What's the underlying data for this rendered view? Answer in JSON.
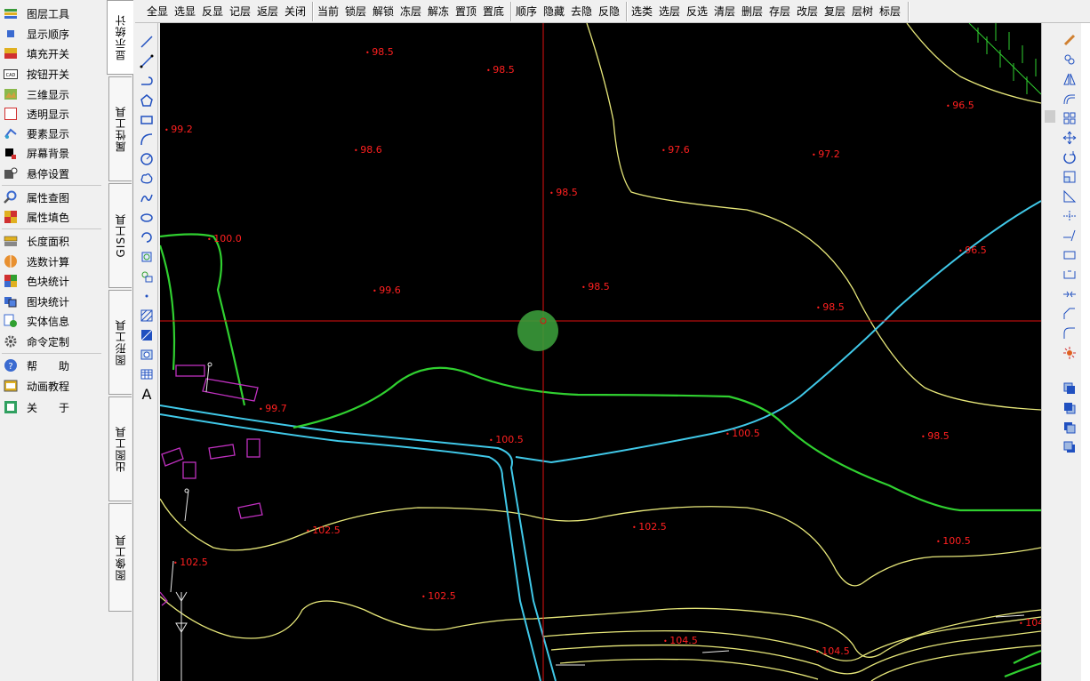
{
  "left_menu": [
    {
      "label": "图层工具",
      "icon": "layer-tool-icon"
    },
    {
      "label": "显示顺序",
      "icon": "display-order-icon"
    },
    {
      "label": "填充开关",
      "icon": "fill-toggle-icon"
    },
    {
      "label": "按钮开关",
      "icon": "cad-button-icon"
    },
    {
      "label": "三维显示",
      "icon": "3d-display-icon"
    },
    {
      "label": "透明显示",
      "icon": "transparent-icon"
    },
    {
      "label": "要素显示",
      "icon": "feature-display-icon"
    },
    {
      "label": "屏幕背景",
      "icon": "screen-bg-icon"
    },
    {
      "label": "悬停设置",
      "icon": "hover-settings-icon"
    },
    {
      "label": "属性查图",
      "icon": "attribute-search-icon"
    },
    {
      "label": "属性填色",
      "icon": "attribute-fill-icon"
    },
    {
      "label": "长度面积",
      "icon": "length-area-icon"
    },
    {
      "label": "选数计算",
      "icon": "calc-icon"
    },
    {
      "label": "色块统计",
      "icon": "color-block-icon"
    },
    {
      "label": "图块统计",
      "icon": "block-stat-icon"
    },
    {
      "label": "实体信息",
      "icon": "entity-info-icon"
    },
    {
      "label": "命令定制",
      "icon": "gear-icon"
    },
    {
      "label": "帮　　助",
      "icon": "help-icon"
    },
    {
      "label": "动画教程",
      "icon": "tutorial-icon"
    },
    {
      "label": "关　　于",
      "icon": "about-icon"
    }
  ],
  "vertical_tabs": [
    "显示统计",
    "属性工具",
    "GIS工具",
    "图形工具",
    "出图工具",
    "图像工具"
  ],
  "toolbar": {
    "group1": [
      "全显",
      "选显",
      "反显",
      "记层",
      "返层",
      "关闭"
    ],
    "group2": [
      "当前",
      "锁层",
      "解锁",
      "冻层",
      "解冻",
      "置顶",
      "置底"
    ],
    "group3": [
      "顺序",
      "隐藏",
      "去隐",
      "反隐"
    ],
    "group4": [
      "选类",
      "选层",
      "反选",
      "清层",
      "删层",
      "存层",
      "改层",
      "复层",
      "层树",
      "标层"
    ]
  },
  "elevations": [
    "98.5",
    "98.5",
    "99.2",
    "98.6",
    "97.6",
    "97.2",
    "96.5",
    "98.5",
    "100.0",
    "96.5",
    "99.6",
    "98.5",
    "98.5",
    "99.7",
    "100.5",
    "100.5",
    "98.5",
    "102.5",
    "102.5",
    "100.5",
    "102.5",
    "102.5",
    "104.5",
    "104.5",
    "104"
  ],
  "colors": {
    "canvas_bg": "#000000",
    "contour": "#e8e87a",
    "river": "#40c8e8",
    "road": "#30d030",
    "building": "#c030c0",
    "elevation": "#ff2020",
    "crosshair": "#e01010",
    "cursor": "#3a9a3a"
  },
  "extra_text": "A"
}
